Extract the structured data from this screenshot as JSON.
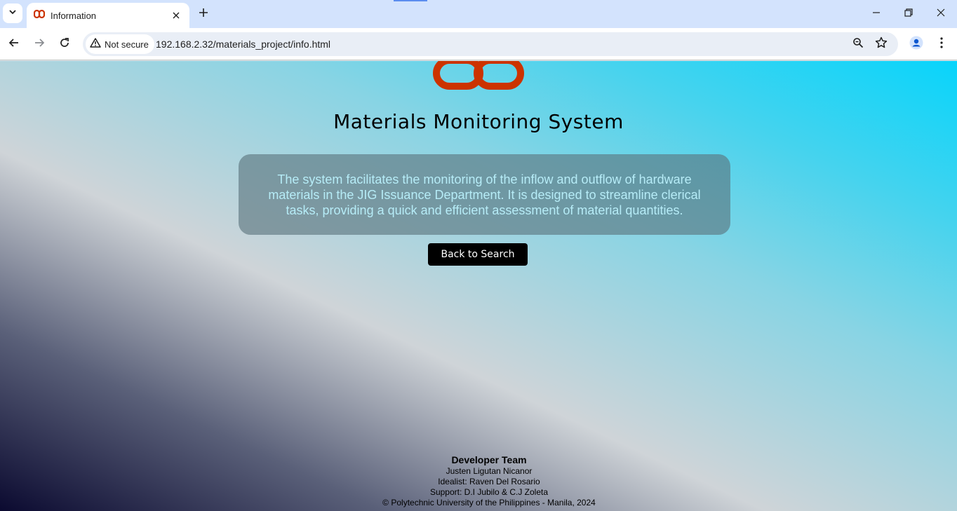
{
  "browser": {
    "tab_title": "Information",
    "security_label": "Not secure",
    "url": "192.168.2.32/materials_project/info.html"
  },
  "page": {
    "title": "Materials Monitoring System",
    "description": "The system facilitates the monitoring of the inflow and outflow of hardware materials in the JIG Issuance Department. It is designed to streamline clerical tasks, providing a quick and efficient assessment of material quantities.",
    "back_button_label": "Back to Search"
  },
  "footer": {
    "heading": "Developer Team",
    "lines": [
      "Justen Ligutan Nicanor",
      "Idealist: Raven Del Rosario",
      "Support: D.I Jubilo & C.J Zoleta",
      "© Polytechnic University of the Philippines - Manila, 2024"
    ]
  },
  "colors": {
    "logo": "#cc3300",
    "desc_text": "#b6ecf7",
    "button_bg": "#000000"
  }
}
